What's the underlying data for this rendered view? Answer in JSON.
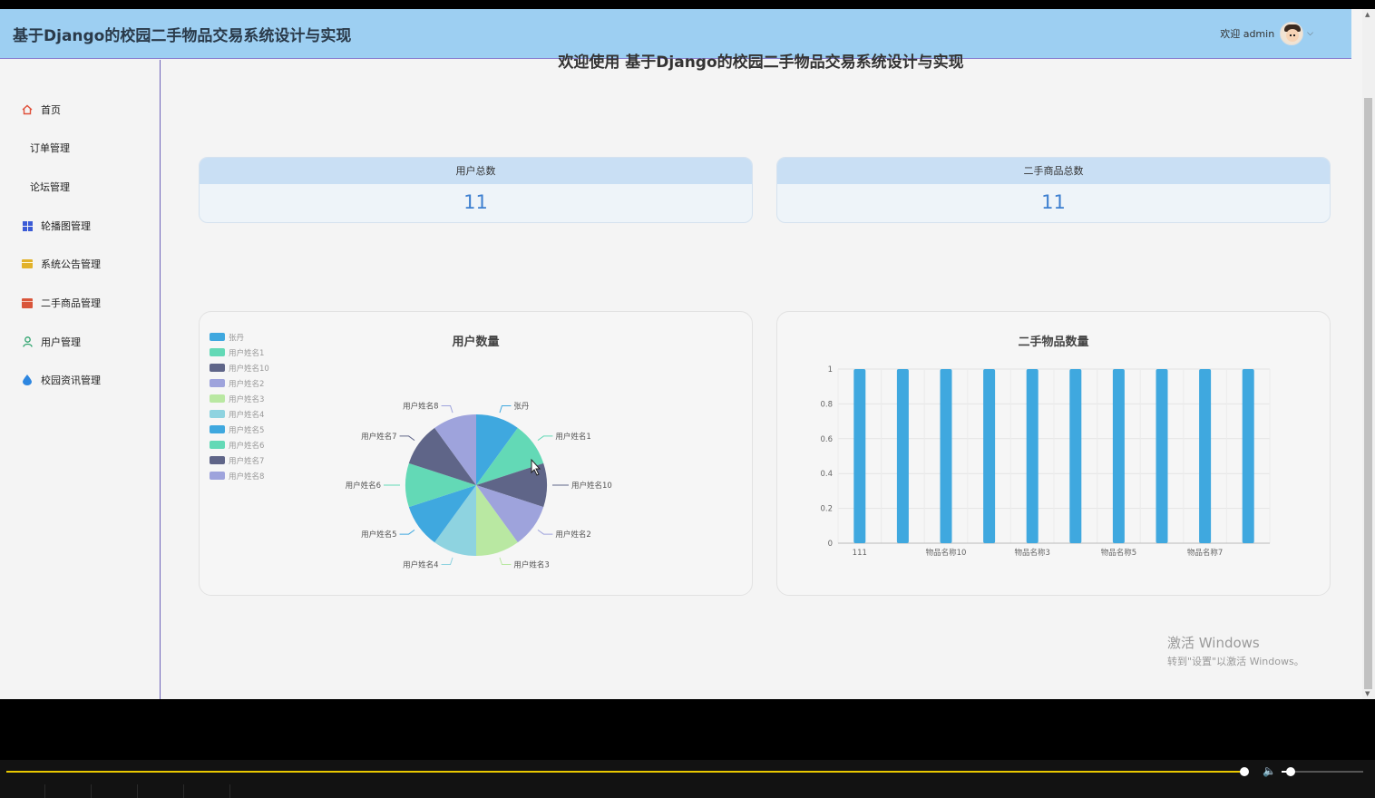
{
  "app": {
    "title": "基于Django的校园二手物品交易系统设计与实现"
  },
  "user": {
    "greeting": "欢迎 admin",
    "avatar_icon": "user-avatar-icon"
  },
  "sidebar": {
    "items": [
      {
        "label": "首页",
        "icon": "home-icon",
        "color": "#e0503a"
      },
      {
        "label": "订单管理",
        "icon": null
      },
      {
        "label": "论坛管理",
        "icon": null
      },
      {
        "label": "轮播图管理",
        "icon": "grid-icon",
        "color": "#3b5bd6"
      },
      {
        "label": "系统公告管理",
        "icon": "notice-icon",
        "color": "#e2b22a"
      },
      {
        "label": "二手商品管理",
        "icon": "box-icon",
        "color": "#d9553a"
      },
      {
        "label": "用户管理",
        "icon": "user-icon",
        "color": "#2aa26b"
      },
      {
        "label": "校园资讯管理",
        "icon": "drop-icon",
        "color": "#2d86e0"
      }
    ]
  },
  "main": {
    "welcome": "欢迎使用 基于Django的校园二手物品交易系统设计与实现",
    "stats": [
      {
        "label": "用户总数",
        "value": "11"
      },
      {
        "label": "二手商品总数",
        "value": "11"
      }
    ]
  },
  "chart_data": [
    {
      "type": "pie",
      "title": "用户数量",
      "legend_position": "top-left",
      "labels": [
        "张丹",
        "用户姓名1",
        "用户姓名10",
        "用户姓名2",
        "用户姓名3",
        "用户姓名4",
        "用户姓名5",
        "用户姓名6",
        "用户姓名7",
        "用户姓名8"
      ],
      "values": [
        1,
        1,
        1,
        1,
        1,
        1,
        1,
        1,
        1,
        1
      ],
      "colors": [
        "#3fa8df",
        "#63d9b6",
        "#5f6588",
        "#9ea3dc",
        "#b9e8a2",
        "#8ed3e0",
        "#3fa8df",
        "#63d9b6",
        "#5f6588",
        "#9ea3dc"
      ]
    },
    {
      "type": "bar",
      "title": "二手物品数量",
      "categories": [
        "111",
        "",
        "物品名称10",
        "",
        "物品名称3",
        "",
        "物品名称5",
        "",
        "物品名称7",
        ""
      ],
      "values": [
        1,
        1,
        1,
        1,
        1,
        1,
        1,
        1,
        1,
        1
      ],
      "ylim": [
        0,
        1
      ],
      "yticks": [
        "0",
        "0.2",
        "0.4",
        "0.6",
        "0.8",
        "1"
      ],
      "grid": true,
      "color": "#3fa8df"
    }
  ],
  "watermark": {
    "title": "激活 Windows",
    "subtitle": "转到\"设置\"以激活 Windows。"
  }
}
